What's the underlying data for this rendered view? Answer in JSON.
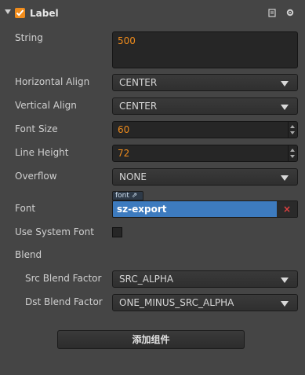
{
  "header": {
    "title": "Label",
    "enabled": true,
    "icons": [
      "book-icon",
      "gear-icon"
    ]
  },
  "properties": {
    "string": {
      "label": "String",
      "value": "500"
    },
    "horizontal_align": {
      "label": "Horizontal Align",
      "value": "CENTER"
    },
    "vertical_align": {
      "label": "Vertical Align",
      "value": "CENTER"
    },
    "font_size": {
      "label": "Font Size",
      "value": "60"
    },
    "line_height": {
      "label": "Line Height",
      "value": "72"
    },
    "overflow": {
      "label": "Overflow",
      "value": "NONE"
    },
    "font": {
      "label": "Font",
      "tag": "font",
      "value": "sz-export",
      "clear": "×"
    },
    "use_system_font": {
      "label": "Use System Font",
      "checked": false
    },
    "blend": {
      "label": "Blend"
    },
    "src_blend_factor": {
      "label": "Src Blend Factor",
      "value": "SRC_ALPHA"
    },
    "dst_blend_factor": {
      "label": "Dst Blend Factor",
      "value": "ONE_MINUS_SRC_ALPHA"
    }
  },
  "footer": {
    "add_component_label": "添加组件"
  },
  "colors": {
    "accent": "#f08c1c",
    "asset": "#3d7bbf",
    "background": "#454545"
  }
}
